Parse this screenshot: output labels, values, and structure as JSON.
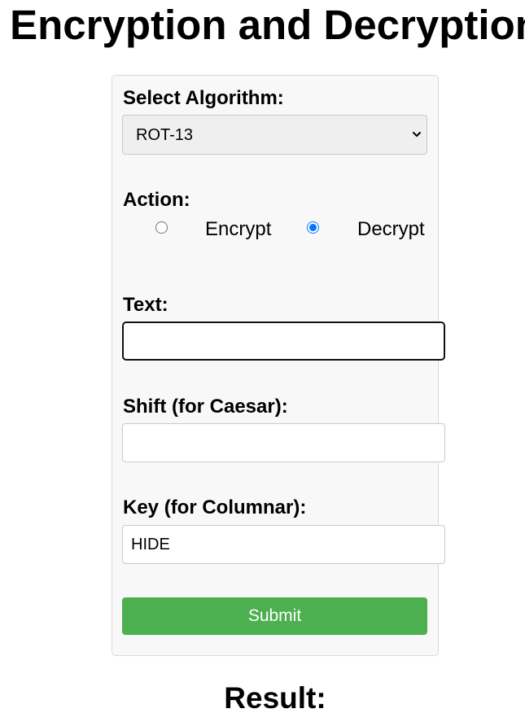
{
  "page": {
    "title": "Encryption and Decryption",
    "result_heading": "Result:"
  },
  "form": {
    "algorithm_label": "Select Algorithm:",
    "algorithm_selected": "ROT-13",
    "action_label": "Action:",
    "actions": [
      {
        "label": "Encrypt",
        "checked": false
      },
      {
        "label": "Decrypt",
        "checked": true
      }
    ],
    "text_label": "Text:",
    "text_value": "",
    "shift_label": "Shift (for Caesar):",
    "shift_value": "",
    "key_label": "Key (for Columnar):",
    "key_value": "HIDE",
    "submit_label": "Submit"
  },
  "colors": {
    "submit_bg": "#4caf50",
    "radio_accent": "#0075ff",
    "card_bg": "#f8f8f8"
  },
  "icons": {
    "select_arrow": "chevron-down-icon"
  }
}
